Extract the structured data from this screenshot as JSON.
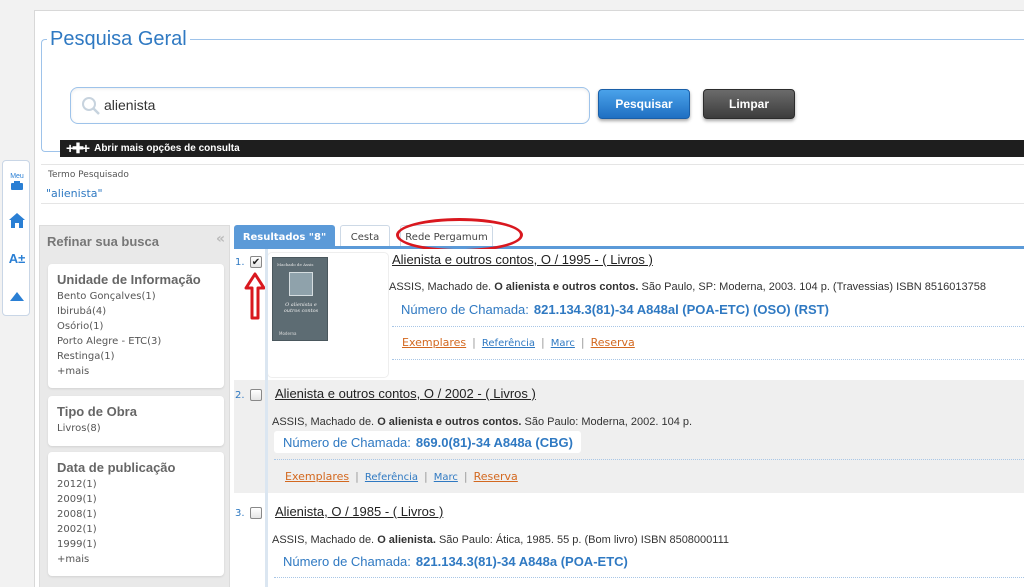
{
  "side_toolbar": {
    "meu_label": "Meu",
    "font_label": "A±"
  },
  "search": {
    "title": "Pesquisa Geral",
    "query": "alienista",
    "search_button": "Pesquisar",
    "clear_button": "Limpar",
    "more_options": "Abrir mais opções de consulta"
  },
  "term": {
    "label": "Termo Pesquisado",
    "value": "\"alienista\""
  },
  "refine": {
    "title": "Refinar sua busca",
    "groups": [
      {
        "title": "Unidade de Informação",
        "items": [
          "Bento Gonçalves(1)",
          "Ibirubá(4)",
          "Osório(1)",
          "Porto Alegre - ETC(3)",
          "Restinga(1)",
          "+mais"
        ]
      },
      {
        "title": "Tipo de Obra",
        "items": [
          "Livros(8)"
        ]
      },
      {
        "title": "Data de publicação",
        "items": [
          "2012(1)",
          "2009(1)",
          "2008(1)",
          "2002(1)",
          "1999(1)",
          "+mais"
        ]
      }
    ]
  },
  "tabs": {
    "results": "Resultados \"8\"",
    "cesta": "Cesta",
    "rede": "Rede Pergamum"
  },
  "results": [
    {
      "num": "1.",
      "checked": true,
      "title": "Alienista e outros contos, O / 1995 - ( Livros )",
      "author": "ASSIS, Machado de.",
      "work": "O alienista e outros contos.",
      "imprint": "São Paulo, SP: Moderna, 2003. 104 p. (Travessias) ISBN 8516013758",
      "callno_label": "Número de Chamada:",
      "callno": "821.134.3(81)-34 A848al (POA-ETC) (OSO) (RST)",
      "cover": {
        "top": "Machado de Assis",
        "sub": "O alienista e outros contos",
        "pub": "Moderna"
      }
    },
    {
      "num": "2.",
      "checked": false,
      "title": "Alienista e outros contos, O / 2002 - ( Livros )",
      "author": "ASSIS, Machado de.",
      "work": "O alienista e outros contos.",
      "imprint": "São Paulo: Moderna, 2002. 104 p.",
      "callno_label": "Número de Chamada:",
      "callno": "869.0(81)-34 A848a (CBG)"
    },
    {
      "num": "3.",
      "checked": false,
      "title": "Alienista, O / 1985 - ( Livros )",
      "author": "ASSIS, Machado de.",
      "work": "O alienista.",
      "imprint": "São Paulo: Ática, 1985. 55 p. (Bom livro) ISBN 8508000111",
      "callno_label": "Número de Chamada:",
      "callno": "821.134.3(81)-34 A848a (POA-ETC)"
    }
  ],
  "links": {
    "exemplares": "Exemplares",
    "referencia": "Referência",
    "marc": "Marc",
    "reserva": "Reserva"
  },
  "colors": {
    "accent": "#2f79c2",
    "annotation": "#d9181f",
    "link_orange": "#d3681f"
  }
}
